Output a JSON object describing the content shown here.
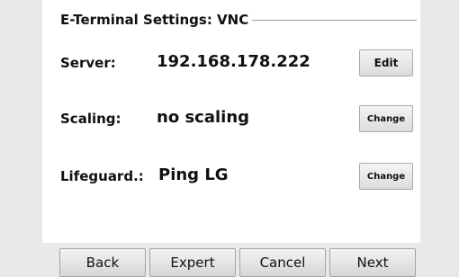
{
  "title": "E-Terminal Settings: VNC",
  "settings": [
    {
      "label": "Server:",
      "value": "192.168.178.222",
      "button": "Edit"
    },
    {
      "label": "Scaling:",
      "value": "no scaling",
      "button": "Change"
    },
    {
      "label": "Lifeguard.:",
      "value": "Ping LG",
      "button": "Change"
    }
  ],
  "footer": {
    "back": "Back",
    "expert": "Expert",
    "cancel": "Cancel",
    "next": "Next"
  },
  "colors": {
    "background": "#e9e9e9",
    "panel": "#ffffff",
    "button_border": "#a9a9a9"
  }
}
